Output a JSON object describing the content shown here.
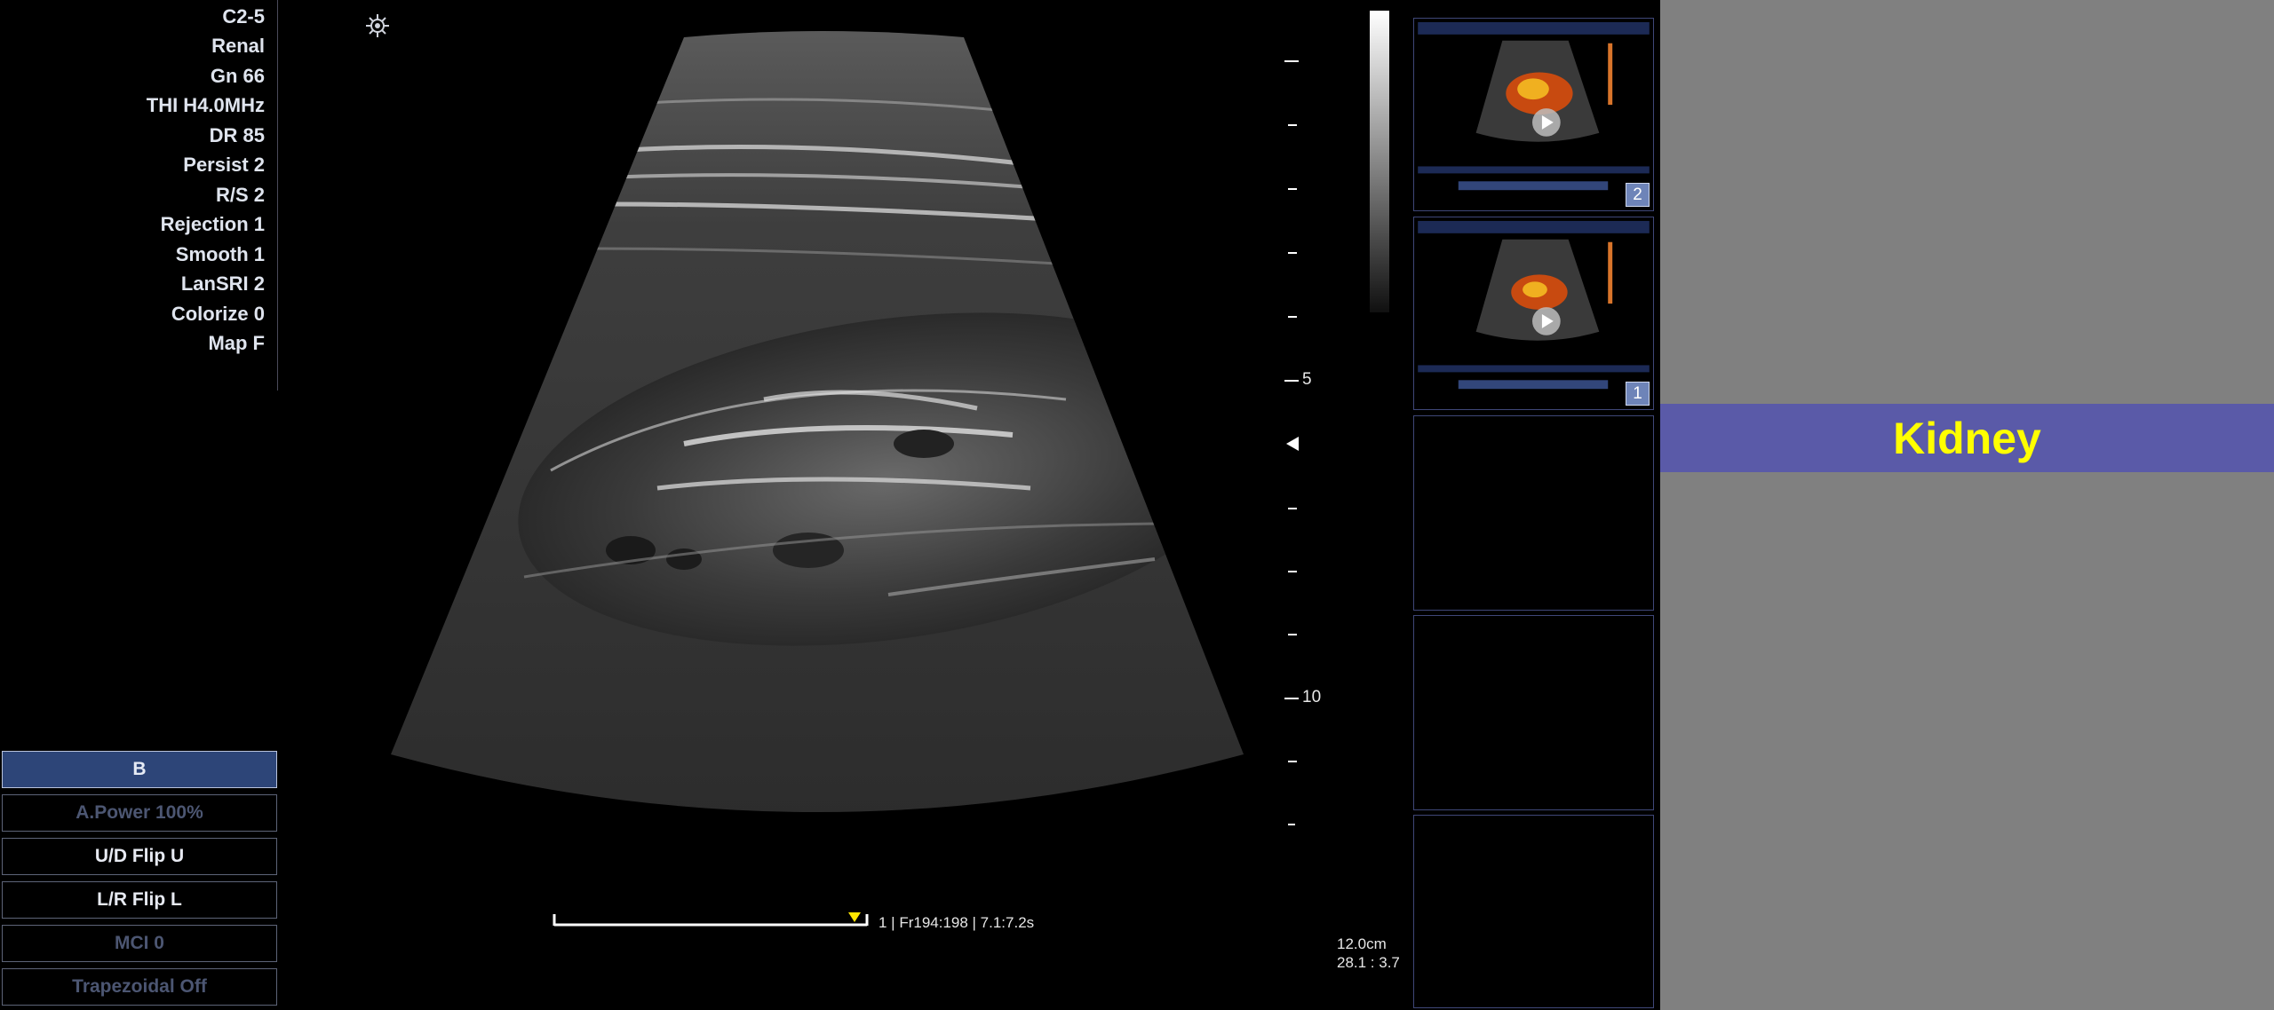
{
  "parameters": [
    "C2-5",
    "Renal",
    "Gn 66",
    "THI H4.0MHz",
    "DR 85",
    "Persist 2",
    "R/S 2",
    "Rejection 1",
    "Smooth 1",
    "LanSRI 2",
    "Colorize 0",
    "Map F"
  ],
  "mode_buttons": [
    {
      "label": "B",
      "state": "active"
    },
    {
      "label": "A.Power 100%",
      "state": "disabled"
    },
    {
      "label": "U/D Flip  U",
      "state": "normal"
    },
    {
      "label": "L/R Flip  L",
      "state": "normal"
    },
    {
      "label": "MCI 0",
      "state": "disabled"
    },
    {
      "label": "Trapezoidal  Off",
      "state": "disabled"
    }
  ],
  "depth_scale": {
    "labels": {
      "five": "5",
      "ten": "10"
    }
  },
  "cine": {
    "readout": "1 | Fr194:198 | 7.1:7.2s"
  },
  "depth_readout": {
    "depth": "12.0cm",
    "ratio": "28.1 : 3.7"
  },
  "clipboard": {
    "thumbnails": [
      {
        "badge": "2"
      },
      {
        "badge": "1"
      }
    ]
  },
  "banner": {
    "title": "Kidney"
  },
  "colors": {
    "active_button": "#2d4578",
    "banner_bg": "#5a5aa8",
    "banner_text": "#ffff00",
    "right_pane": "#808080"
  }
}
